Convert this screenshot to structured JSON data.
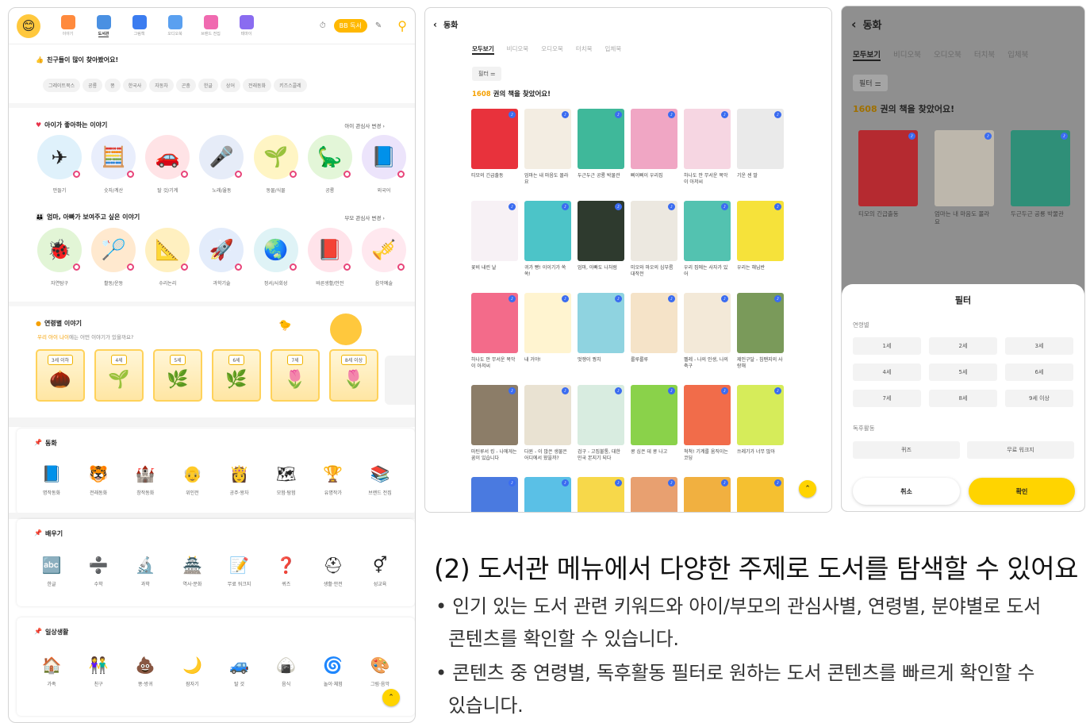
{
  "left": {
    "nav": [
      {
        "label": "이야기",
        "icon": "house-icon",
        "color": "#ff8a3d"
      },
      {
        "label": "도서관",
        "icon": "library-icon",
        "color": "#4a90e2",
        "active": true
      },
      {
        "label": "그림책",
        "icon": "picturebook-icon",
        "color": "#3b7cf0"
      },
      {
        "label": "오디오북",
        "icon": "headphone-icon",
        "color": "#5aa0f0"
      },
      {
        "label": "브랜드 전집",
        "icon": "book-set-icon",
        "color": "#f06ab0"
      },
      {
        "label": "테마이",
        "icon": "theme-icon",
        "color": "#8a6cf0"
      }
    ],
    "read_button": "BB 독서",
    "popular": {
      "title": "친구들이 많이 찾아봤어요!",
      "chips": [
        "그레이트북스",
        "공룡",
        "똥",
        "한국사",
        "자동차",
        "곤충",
        "한글",
        "상어",
        "전래동화",
        "키즈스콜레"
      ]
    },
    "child": {
      "title": "아이가 좋아하는 이야기",
      "more": "아이 관심사 변경",
      "items": [
        {
          "label": "만들기",
          "icon": "✈",
          "bg": "#dff1fb"
        },
        {
          "label": "숫자/계산",
          "icon": "🧮",
          "bg": "#e9eefc"
        },
        {
          "label": "탈 것/기계",
          "icon": "🚗",
          "bg": "#ffe3e6"
        },
        {
          "label": "노래/율동",
          "icon": "🎤",
          "bg": "#e6ecf8"
        },
        {
          "label": "동물/식물",
          "icon": "🌱",
          "bg": "#fff5c4"
        },
        {
          "label": "공룡",
          "icon": "🦕",
          "bg": "#e3f6d8"
        },
        {
          "label": "외국어",
          "icon": "📘",
          "bg": "#ece4fb"
        }
      ]
    },
    "parent": {
      "title": "엄마, 아빠가 보여주고 싶은 이야기",
      "more": "부모 관심사 변경",
      "items": [
        {
          "label": "자연탐구",
          "icon": "🐞",
          "bg": "#e2f5d6"
        },
        {
          "label": "활동/운동",
          "icon": "🏸",
          "bg": "#ffe9cf"
        },
        {
          "label": "수리논리",
          "icon": "📐",
          "bg": "#fff0c0"
        },
        {
          "label": "과학기술",
          "icon": "🚀",
          "bg": "#e3ecfb"
        },
        {
          "label": "정서/사회성",
          "icon": "🌏",
          "bg": "#dff3f6"
        },
        {
          "label": "바른생활/안전",
          "icon": "📕",
          "bg": "#ffe3ea"
        },
        {
          "label": "음악예술",
          "icon": "🎺",
          "bg": "#ffe8ef"
        }
      ]
    },
    "age": {
      "title": "연령별 이야기",
      "subtitle_highlight": "우리 아이 나이",
      "subtitle_rest": "에는 어떤 이야기가 있을까요?",
      "cards": [
        {
          "label": "3세 이하",
          "icon": "🌰"
        },
        {
          "label": "4세",
          "icon": "🌱"
        },
        {
          "label": "5세",
          "icon": "🌿"
        },
        {
          "label": "6세",
          "icon": "🌿"
        },
        {
          "label": "7세",
          "icon": "🌷"
        },
        {
          "label": "8세 이상",
          "icon": "🌷"
        }
      ]
    },
    "fairy": {
      "title": "동화",
      "items": [
        {
          "label": "명작동화",
          "icon": "📘"
        },
        {
          "label": "전래동화",
          "icon": "🐯"
        },
        {
          "label": "창작동화",
          "icon": "🏰"
        },
        {
          "label": "위인전",
          "icon": "👴"
        },
        {
          "label": "공주·왕자",
          "icon": "👸"
        },
        {
          "label": "모험·탐험",
          "icon": "🗺"
        },
        {
          "label": "유명작가",
          "icon": "🏆"
        },
        {
          "label": "브랜드 전집",
          "icon": "📚"
        }
      ]
    },
    "learn": {
      "title": "배우기",
      "items": [
        {
          "label": "한글",
          "icon": "🔤"
        },
        {
          "label": "수학",
          "icon": "➗"
        },
        {
          "label": "과학",
          "icon": "🔬"
        },
        {
          "label": "역사·문화",
          "icon": "🏯"
        },
        {
          "label": "무료 워크지",
          "icon": "📝"
        },
        {
          "label": "퀴즈",
          "icon": "❓"
        },
        {
          "label": "생활·안전",
          "icon": "⛑"
        },
        {
          "label": "성교육",
          "icon": "⚥"
        }
      ]
    },
    "daily": {
      "title": "일상생활",
      "items": [
        {
          "label": "가족",
          "icon": "🏠"
        },
        {
          "label": "친구",
          "icon": "👫"
        },
        {
          "label": "똥·방귀",
          "icon": "💩"
        },
        {
          "label": "잠자기",
          "icon": "🌙"
        },
        {
          "label": "탈 것",
          "icon": "🚙"
        },
        {
          "label": "음식",
          "icon": "🍙"
        },
        {
          "label": "놀이·체험",
          "icon": "🌀"
        },
        {
          "label": "그림·음악",
          "icon": "🎨"
        }
      ]
    }
  },
  "middle": {
    "back_title": "동화",
    "tabs": [
      "모두보기",
      "비디오북",
      "오디오북",
      "터치북",
      "입체북"
    ],
    "filter": "필터",
    "count": "1608",
    "count_suffix": " 권의 책을 찾았어요!",
    "books": [
      {
        "t": "티모의 긴급출동",
        "bg": "#e8323c"
      },
      {
        "t": "엄마는 내 마음도 몰라요",
        "bg": "#f3ede2"
      },
      {
        "t": "두근두근 공룡 박물관",
        "bg": "#3fb89a"
      },
      {
        "t": "삐이삐이 우리집",
        "bg": "#f0a6c4"
      },
      {
        "t": "하나도 안 무서운 목악이 아저씨",
        "bg": "#f6d6e2"
      },
      {
        "t": "기운 센 말",
        "bg": "#eaeaea"
      },
      {
        "t": "꽃비 내린 날",
        "bg": "#f7f1f5"
      },
      {
        "t": "귀가 빵! 이이기가 쏙쏙!",
        "bg": "#4cc4c8"
      },
      {
        "t": "엄마, 아빠도 나처럼",
        "bg": "#2e3a2e"
      },
      {
        "t": "미오와 마오의 심부름 대작전",
        "bg": "#ece8e0"
      },
      {
        "t": "우리 집에는 사자가 있어",
        "bg": "#53c2b0"
      },
      {
        "t": "우리는 해님반",
        "bg": "#f6e23a"
      },
      {
        "t": "하나도 안 무서운 목악이 아저씨",
        "bg": "#f36b8a"
      },
      {
        "t": "내 거야!",
        "bg": "#fff4d0"
      },
      {
        "t": "멋쟁이 꿩치",
        "bg": "#8fd3e0"
      },
      {
        "t": "룰루룰루",
        "bg": "#f5e3c8"
      },
      {
        "t": "펠레 - 나의 인생, 나의 축구",
        "bg": "#f3e9d8"
      },
      {
        "t": "제인구달 - 침팬지의 사랑해",
        "bg": "#7a9a5a"
      },
      {
        "t": "마틴루서 킹 - 나에게는 꿈이 있습니다",
        "bg": "#8c7d68"
      },
      {
        "t": "다윈 - 이 많은 생물은 어디에서 왔을까?",
        "bg": "#e9e2d2"
      },
      {
        "t": "검구 - 고집불통, 대한민국 본지기 되다",
        "bg": "#d8ece0"
      },
      {
        "t": "콩 심은 데 콩 나고",
        "bg": "#8ad24a"
      },
      {
        "t": "척척! 기계를 움직이는 코딩",
        "bg": "#f16c4a"
      },
      {
        "t": "쓰레기가 너무 많아",
        "bg": "#d6ec5a"
      },
      {
        "t": "",
        "bg": "#4a7ae0"
      },
      {
        "t": "",
        "bg": "#5ac0e6"
      },
      {
        "t": "",
        "bg": "#f7d84a"
      },
      {
        "t": "",
        "bg": "#e8a070"
      },
      {
        "t": "",
        "bg": "#f1b040"
      },
      {
        "t": "",
        "bg": "#f5c030"
      }
    ]
  },
  "right": {
    "back_title": "동화",
    "tabs": [
      "모두보기",
      "비디오북",
      "오디오북",
      "터치북",
      "입체북"
    ],
    "filter": "필터",
    "count": "1608",
    "count_suffix": " 권의 책을 찾았어요!",
    "books": [
      {
        "t": "티모의 긴급출동",
        "bg": "#b52a30"
      },
      {
        "t": "엄마는 내 마음도 몰라요",
        "bg": "#bdb7ac"
      },
      {
        "t": "두근두근 공룡 박물관",
        "bg": "#2f8f78"
      }
    ],
    "sheet": {
      "title": "필터",
      "age_label": "연령별",
      "ages": [
        "1세",
        "2세",
        "3세",
        "4세",
        "5세",
        "6세",
        "7세",
        "8세",
        "9세 이상"
      ],
      "activity_label": "독후활동",
      "activities": [
        "퀴즈",
        "무료 워크지"
      ],
      "cancel": "취소",
      "confirm": "확인"
    }
  },
  "text": {
    "heading": "(2) 도서관 메뉴에서 다양한 주제로 도서를 탐색할 수 있어요",
    "bullets": [
      [
        "• 인기 있는 도서 관련 키워드와 아이/부모의 관심사별, 연령별, 분야별로 도서",
        "콘텐츠를 확인할 수 있습니다."
      ],
      [
        "• 콘텐츠 중 연령별, 독후활동 필터로 원하는 도서 콘텐츠를 빠르게 확인할 수",
        "있습니다."
      ]
    ]
  }
}
